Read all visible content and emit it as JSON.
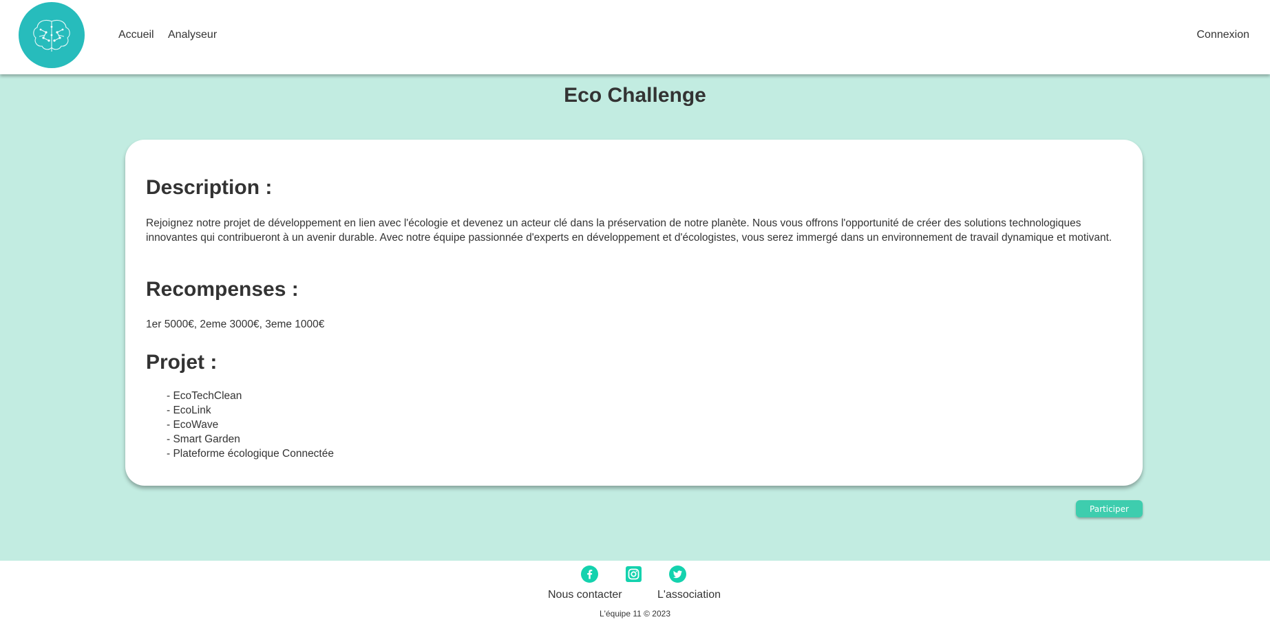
{
  "header": {
    "nav": {
      "home": "Accueil",
      "analyzer": "Analyseur"
    },
    "login": "Connexion"
  },
  "main": {
    "title": "Eco Challenge",
    "description_heading": "Description :",
    "description_text": "Rejoignez notre projet de développement en lien avec l'écologie et devenez un acteur clé dans la préservation de notre planète. Nous vous offrons l'opportunité de créer des solutions technologiques innovantes qui contribueront à un avenir durable. Avec notre équipe passionnée d'experts en développement et d'écologistes, vous serez immergé dans un environnement de travail dynamique et motivant.",
    "rewards_heading": "Recompenses :",
    "rewards_text": "1er 5000€, 2eme 3000€, 3eme 1000€",
    "project_heading": "Projet :",
    "projects": [
      "- EcoTechClean",
      "- EcoLink",
      "- EcoWave",
      "- Smart Garden",
      "- Plateforme écologique Connectée"
    ],
    "participate_button": "Participer"
  },
  "footer": {
    "social_icons": [
      "facebook-icon",
      "instagram-icon",
      "twitter-icon"
    ],
    "contact": "Nous contacter",
    "association": "L'association",
    "copyright": "L'équipe 11 © 2023"
  },
  "colors": {
    "logo_bg": "#27bcbc",
    "page_bg": "#c2ece1",
    "accent": "#3ecdae",
    "social": "#14d2ae",
    "text": "#333333"
  }
}
